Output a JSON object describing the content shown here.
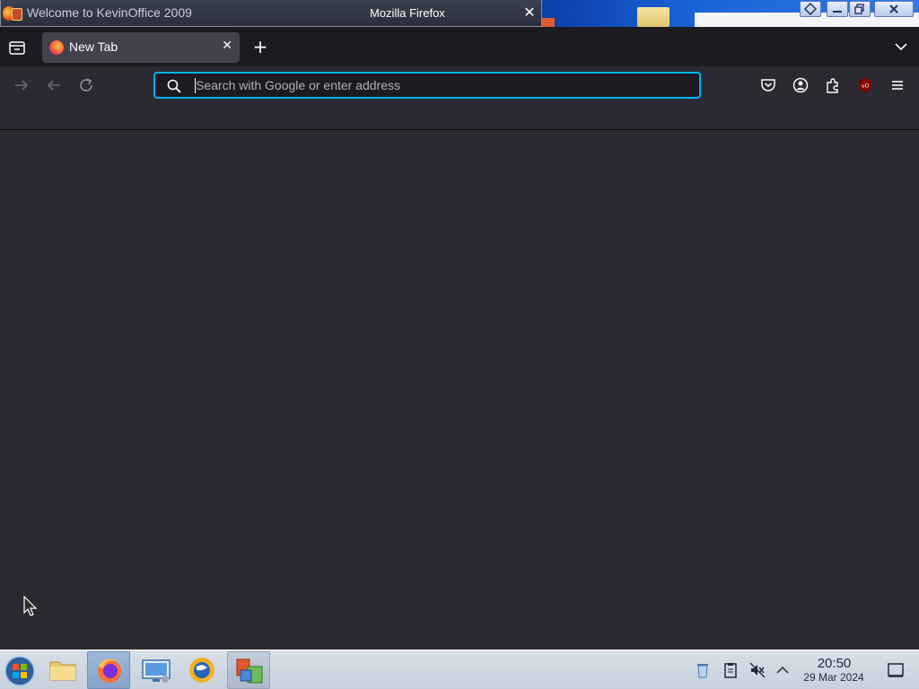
{
  "window": {
    "doc_title": "Welcome to KevinOffice 2009",
    "app_title": "Mozilla Firefox",
    "close_glyph": "✕"
  },
  "tabs": [
    {
      "label": "New Tab",
      "icon": "firefox-icon"
    }
  ],
  "tabstrip": {
    "new_tab_glyph": "+",
    "close_tab_glyph": "✕"
  },
  "urlbar": {
    "placeholder": "Search with Google or enter address",
    "value": ""
  },
  "toolbar_icons": [
    "pocket-icon",
    "account-icon",
    "extensions-icon",
    "ublock-icon",
    "menu-icon"
  ],
  "taskbar": {
    "apps": [
      "start-orb",
      "file-manager",
      "firefox",
      "remote-desktop",
      "kevinoffice-sun",
      "kevinoffice-docs"
    ],
    "clock": {
      "time": "20:50",
      "date": "29 Mar 2024"
    }
  },
  "colors": {
    "chrome_bg": "#1c1b22",
    "toolbar_bg": "#2b2a33",
    "tab_active_bg": "#42414d",
    "focus_ring": "#00b3f4",
    "taskbar_bg": "#d8dfe8"
  }
}
